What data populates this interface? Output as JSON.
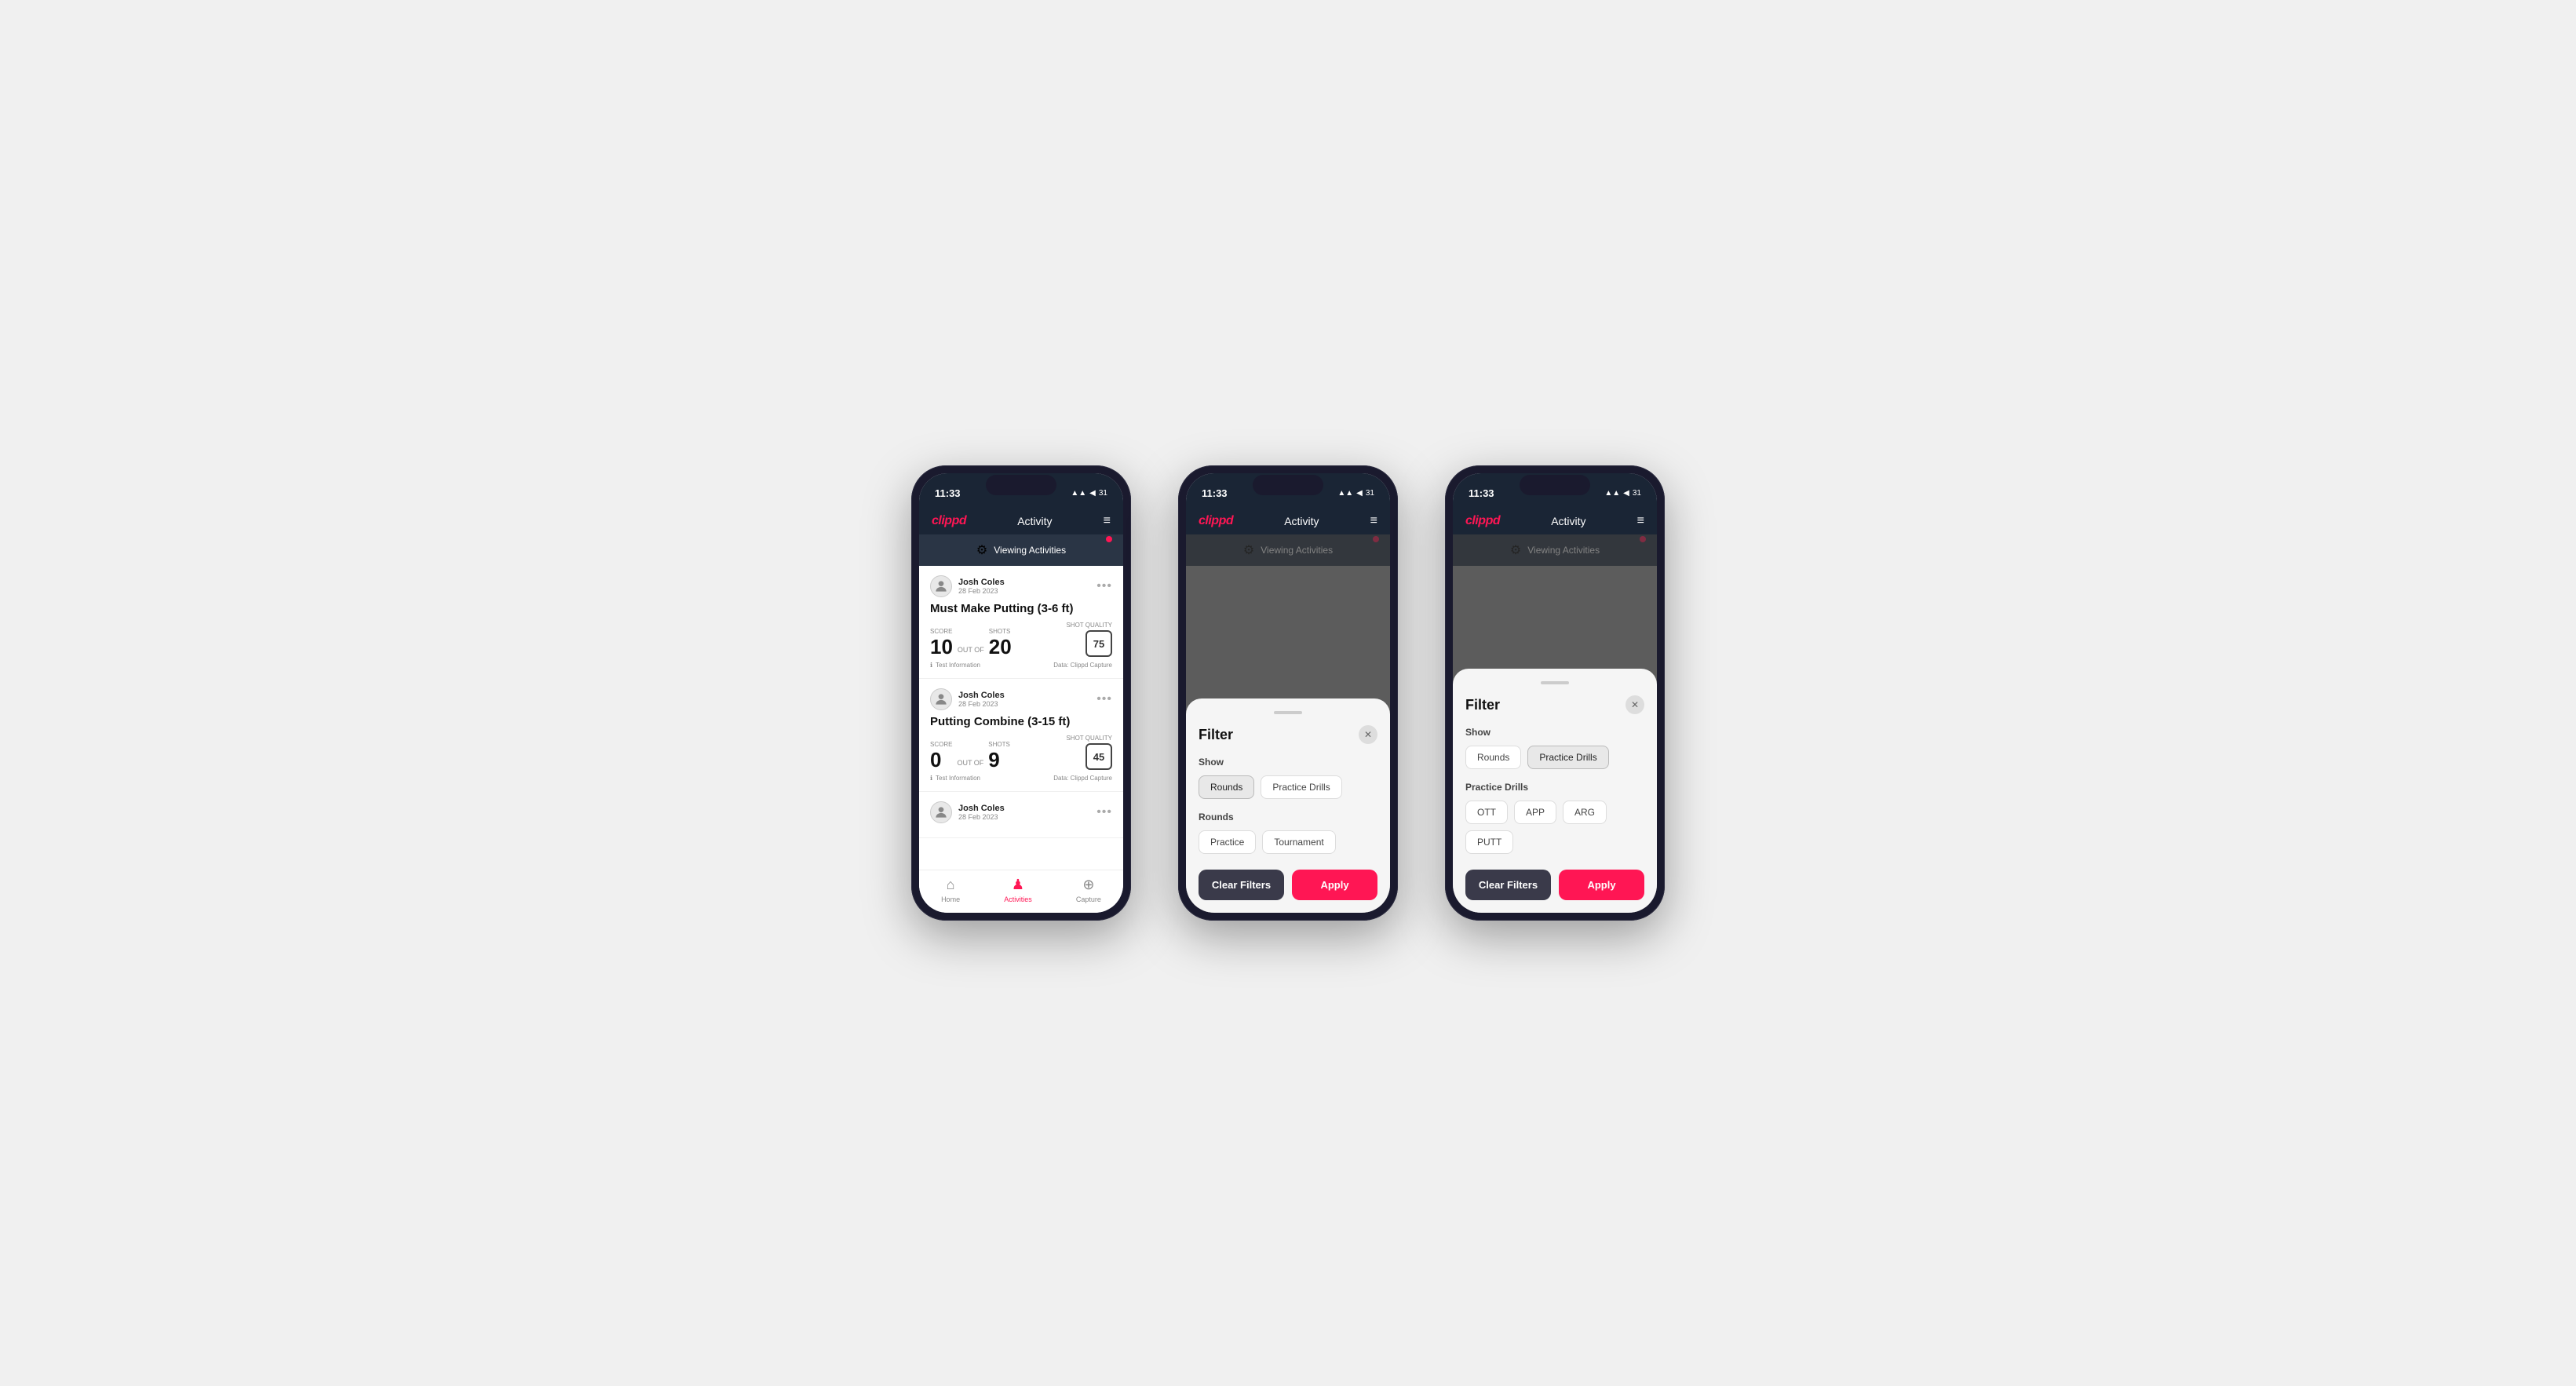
{
  "phones": [
    {
      "id": "phone1",
      "statusBar": {
        "time": "11:33",
        "icons": "▲▲ ◀ 31"
      },
      "nav": {
        "logo": "clippd",
        "title": "Activity",
        "menuIcon": "≡"
      },
      "viewingBar": {
        "icon": "⚙",
        "text": "Viewing Activities"
      },
      "activities": [
        {
          "user": "Josh Coles",
          "date": "28 Feb 2023",
          "title": "Must Make Putting (3-6 ft)",
          "score": "10",
          "outOf": "OUT OF",
          "shots": "20",
          "scoreLabel": "Score",
          "shotsLabel": "Shots",
          "shotQualityLabel": "Shot Quality",
          "shotQuality": "75",
          "info": "Test Information",
          "dataSource": "Data: Clippd Capture"
        },
        {
          "user": "Josh Coles",
          "date": "28 Feb 2023",
          "title": "Putting Combine (3-15 ft)",
          "score": "0",
          "outOf": "OUT OF",
          "shots": "9",
          "scoreLabel": "Score",
          "shotsLabel": "Shots",
          "shotQualityLabel": "Shot Quality",
          "shotQuality": "45",
          "info": "Test Information",
          "dataSource": "Data: Clippd Capture"
        },
        {
          "user": "Josh Coles",
          "date": "28 Feb 2023",
          "title": "",
          "score": "",
          "outOf": "",
          "shots": "",
          "scoreLabel": "",
          "shotsLabel": "",
          "shotQualityLabel": "",
          "shotQuality": "",
          "info": "",
          "dataSource": ""
        }
      ],
      "bottomNav": [
        {
          "label": "Home",
          "icon": "⌂",
          "active": false
        },
        {
          "label": "Activities",
          "icon": "♟",
          "active": true
        },
        {
          "label": "Capture",
          "icon": "⊕",
          "active": false
        }
      ],
      "showFilter": false
    },
    {
      "id": "phone2",
      "statusBar": {
        "time": "11:33",
        "icons": "▲▲ ◀ 31"
      },
      "nav": {
        "logo": "clippd",
        "title": "Activity",
        "menuIcon": "≡"
      },
      "viewingBar": {
        "icon": "⚙",
        "text": "Viewing Activities"
      },
      "showFilter": true,
      "filter": {
        "title": "Filter",
        "showLabel": "Show",
        "showOptions": [
          "Rounds",
          "Practice Drills"
        ],
        "showActive": "Rounds",
        "roundsLabel": "Rounds",
        "roundsOptions": [
          "Practice",
          "Tournament"
        ],
        "roundsActive": "",
        "clearLabel": "Clear Filters",
        "applyLabel": "Apply"
      }
    },
    {
      "id": "phone3",
      "statusBar": {
        "time": "11:33",
        "icons": "▲▲ ◀ 31"
      },
      "nav": {
        "logo": "clippd",
        "title": "Activity",
        "menuIcon": "≡"
      },
      "viewingBar": {
        "icon": "⚙",
        "text": "Viewing Activities"
      },
      "showFilter": true,
      "filter": {
        "title": "Filter",
        "showLabel": "Show",
        "showOptions": [
          "Rounds",
          "Practice Drills"
        ],
        "showActive": "Practice Drills",
        "drillsLabel": "Practice Drills",
        "drillsOptions": [
          "OTT",
          "APP",
          "ARG",
          "PUTT"
        ],
        "drillsActive": "",
        "clearLabel": "Clear Filters",
        "applyLabel": "Apply"
      }
    }
  ]
}
